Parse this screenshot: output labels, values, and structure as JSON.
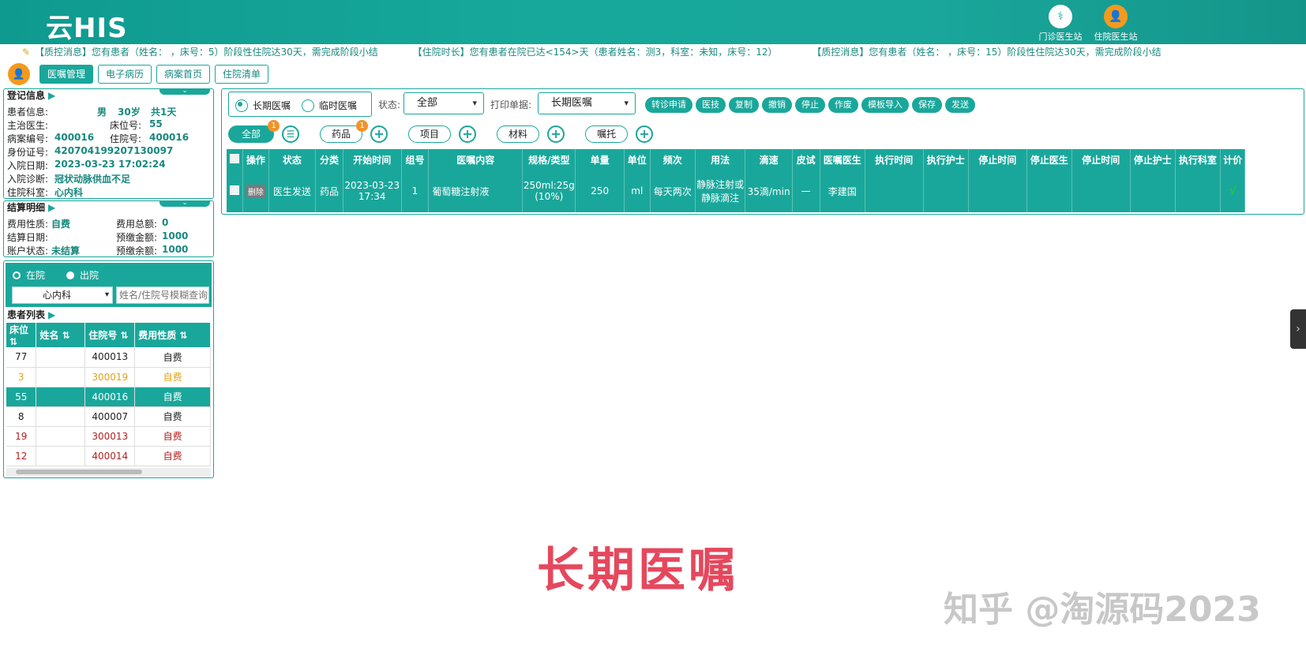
{
  "header": {
    "logo": "云HIS",
    "links": [
      {
        "label": "门诊医生站",
        "icon": "doctor-icon"
      },
      {
        "label": "住院医生站",
        "icon": "inpatient-doctor-icon"
      }
    ]
  },
  "ticker": {
    "messages": [
      "【质控消息】您有患者（姓名：       ，床号：5）阶段性住院达30天，需完成阶段小结",
      "【住院时长】您有患者在院已达<154>天（患者姓名：测3，科室：未知，床号：12）",
      "【质控消息】您有患者（姓名：       ，床号：15）阶段性住院达30天，需完成阶段小结"
    ]
  },
  "tabs": [
    "医嘱管理",
    "电子病历",
    "病案首页",
    "住院清单"
  ],
  "registration": {
    "title": "登记信息",
    "patient_label": "患者信息:",
    "patient_gender": "男",
    "patient_age": "30岁",
    "patient_days": "共1天",
    "doctor_label": "主治医生:",
    "bed_label": "床位号:",
    "bed_value": "55",
    "case_label": "病案编号:",
    "case_value": "400016",
    "admit_no_label": "住院号:",
    "admit_no_value": "400016",
    "id_label": "身份证号:",
    "id_value": "420704199207130097",
    "admit_date_label": "入院日期:",
    "admit_date_value": "2023-03-23 17:02:24",
    "diagnosis_label": "入院诊断:",
    "diagnosis_value": "冠状动脉供血不足",
    "dept_label": "住院科室:",
    "dept_value": "心内科"
  },
  "settlement": {
    "title": "结算明细",
    "fee_type_label": "费用性质:",
    "fee_type_value": "自费",
    "fee_total_label": "费用总额:",
    "fee_total_value": "0",
    "settle_date_label": "结算日期:",
    "prepay_label": "预缴金额:",
    "prepay_value": "1000",
    "account_label": "账户状态:",
    "account_value": "未结算",
    "balance_label": "预缴余额:",
    "balance_value": "1000"
  },
  "patient_filter": {
    "radio_in": "在院",
    "radio_out": "出院",
    "dept": "心内科",
    "search_placeholder": "姓名/住院号模糊查询"
  },
  "patient_list": {
    "title": "患者列表",
    "columns": [
      "床位",
      "姓名",
      "住院号",
      "费用性质"
    ],
    "rows": [
      {
        "bed": "77",
        "name": "",
        "no": "400013",
        "fee": "自费",
        "color": "#222222",
        "selected": false
      },
      {
        "bed": "3",
        "name": "",
        "no": "300019",
        "fee": "自费",
        "color": "#e0a21c",
        "selected": false
      },
      {
        "bed": "55",
        "name": "",
        "no": "400016",
        "fee": "自费",
        "color": "#ffffff",
        "selected": true
      },
      {
        "bed": "8",
        "name": "",
        "no": "400007",
        "fee": "自费",
        "color": "#222222",
        "selected": false
      },
      {
        "bed": "19",
        "name": "",
        "no": "300013",
        "fee": "自费",
        "color": "#b32020",
        "selected": false
      },
      {
        "bed": "12",
        "name": "",
        "no": "400014",
        "fee": "自费",
        "color": "#b32020",
        "selected": false
      }
    ]
  },
  "orders_toolbar": {
    "long_term": "长期医嘱",
    "temporary": "临时医嘱",
    "status_label": "状态:",
    "status_value": "全部",
    "print_label": "打印单据:",
    "print_value": "长期医嘱",
    "actions": [
      "转诊申请",
      "医技",
      "复制",
      "撤销",
      "停止",
      "作废",
      "模板导入",
      "保存",
      "发送"
    ]
  },
  "category_tabs": {
    "all": "全部",
    "all_badge": "1",
    "drug": "药品",
    "drug_badge": "1",
    "item": "项目",
    "material": "材料",
    "entrust": "嘱托"
  },
  "orders_table": {
    "columns": [
      "操作",
      "状态",
      "分类",
      "开始时间",
      "组号",
      "医嘱内容",
      "规格/类型",
      "单量",
      "单位",
      "频次",
      "用法",
      "滴速",
      "皮试",
      "医嘱医生",
      "执行时间",
      "执行护士",
      "停止时间",
      "停止医生",
      "停止时间",
      "停止护士",
      "执行科室",
      "计价"
    ],
    "rows": [
      {
        "op": "删除",
        "status": "医生发送",
        "category": "药品",
        "start_date": "2023-03-23",
        "start_time": "17:34",
        "group": "1",
        "content": "葡萄糖注射液",
        "spec": "250ml:25g (10%)",
        "qty": "250",
        "unit": "ml",
        "freq": "每天两次",
        "usage": "静脉注射或静脉滴注",
        "drip": "35滴/min",
        "skin": "—",
        "doctor": "李建国",
        "exec_time": "",
        "exec_nurse": "",
        "stop_time": "",
        "stop_doctor": "",
        "stop_time2": "",
        "stop_nurse": "",
        "exec_dept": "",
        "priced": "√"
      }
    ]
  },
  "overlay": {
    "caption": "长期医嘱",
    "watermark": "知乎 @淘源码2023"
  },
  "colors": {
    "primary": "#1aa79b",
    "caption": "#e5485d",
    "badge": "#f0932a"
  }
}
